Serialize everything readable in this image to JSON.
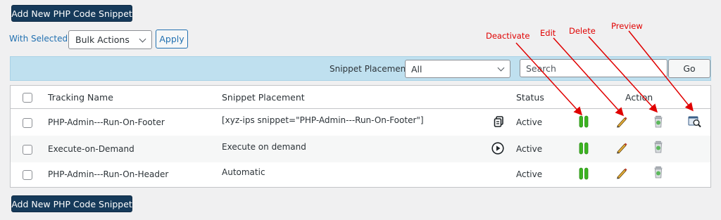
{
  "buttons": {
    "add_new_top": "Add New PHP Code Snippet",
    "add_new_bottom": "Add New PHP Code Snippet",
    "apply": "Apply",
    "go": "Go"
  },
  "bulk": {
    "label": "With Selected :",
    "selected": "Bulk Actions"
  },
  "filter": {
    "placement_label": "Snippet Placement",
    "placement_selected": "All",
    "search_placeholder": "Search"
  },
  "table": {
    "headers": {
      "name": "Tracking Name",
      "placement": "Snippet Placement",
      "status": "Status",
      "action": "Action"
    },
    "rows": [
      {
        "name": "PHP-Admin---Run-On-Footer",
        "placement": "[xyz-ips snippet=\"PHP-Admin---Run-On-Footer\"]",
        "status": "Active",
        "placement_icon": "copy-icon"
      },
      {
        "name": "Execute-on-Demand",
        "placement": "Execute on demand",
        "status": "Active",
        "placement_icon": "play-icon"
      },
      {
        "name": "PHP-Admin---Run-On-Header",
        "placement": "Automatic",
        "status": "Active",
        "placement_icon": ""
      }
    ]
  },
  "annotations": {
    "deactivate": "Deactivate",
    "edit": "Edit",
    "delete": "Delete",
    "preview": "Preview"
  },
  "colors": {
    "primary_dark": "#163a5a",
    "link_blue": "#2271b1",
    "filter_bar": "#bfe0ef",
    "annotation_red": "#e00000",
    "active_green": "#3cb521"
  }
}
